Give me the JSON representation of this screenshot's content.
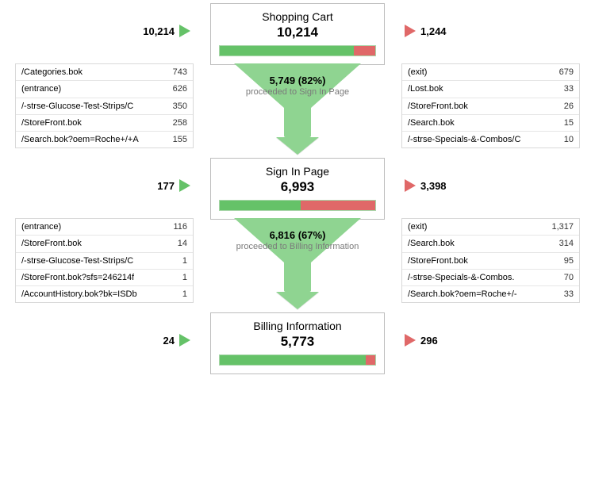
{
  "chart_data": {
    "type": "funnel",
    "stages": [
      {
        "label": "Shopping Cart",
        "count": 10214,
        "inflow": 10214,
        "outflow": 1244,
        "proceeded_count": 5749,
        "proceeded_rate": "82%",
        "proceeded_to": "Sign In Page"
      },
      {
        "label": "Sign In Page",
        "count": 6993,
        "inflow": 177,
        "outflow": 3398,
        "proceeded_count": 6816,
        "proceeded_rate": "67%",
        "proceeded_to": "Billing Information"
      },
      {
        "label": "Billing Information",
        "count": 5773,
        "inflow": 24,
        "outflow": 296
      }
    ]
  },
  "stages": [
    {
      "title": "Shopping Cart",
      "count": "10,214",
      "inflow": "10,214",
      "outflow": "1,244",
      "bar_red_style": "width:14%",
      "proceeded_num": "5,749 (82%)",
      "proceeded_txt": "proceeded to Sign In Page",
      "in_rows": [
        {
          "path": "/Categories.bok",
          "val": "743"
        },
        {
          "path": "(entrance)",
          "val": "626"
        },
        {
          "path": "/-strse-Glucose-Test-Strips/C",
          "val": "350"
        },
        {
          "path": "/StoreFront.bok",
          "val": "258"
        },
        {
          "path": "/Search.bok?oem=Roche+/+A",
          "val": "155"
        }
      ],
      "out_rows": [
        {
          "path": "(exit)",
          "val": "679"
        },
        {
          "path": "/Lost.bok",
          "val": "33"
        },
        {
          "path": "/StoreFront.bok",
          "val": "26"
        },
        {
          "path": "/Search.bok",
          "val": "15"
        },
        {
          "path": "/-strse-Specials-&-Combos/C",
          "val": "10"
        }
      ]
    },
    {
      "title": "Sign In Page",
      "count": "6,993",
      "inflow": "177",
      "outflow": "3,398",
      "bar_red_style": "width:48%",
      "proceeded_num": "6,816 (67%)",
      "proceeded_txt": "proceeded to Billing Information",
      "in_rows": [
        {
          "path": "(entrance)",
          "val": "116"
        },
        {
          "path": "/StoreFront.bok",
          "val": "14"
        },
        {
          "path": "/-strse-Glucose-Test-Strips/C",
          "val": "1"
        },
        {
          "path": "/StoreFront.bok?sfs=246214f",
          "val": "1"
        },
        {
          "path": "/AccountHistory.bok?bk=ISDb",
          "val": "1"
        }
      ],
      "out_rows": [
        {
          "path": "(exit)",
          "val": "1,317"
        },
        {
          "path": "/Search.bok",
          "val": "314"
        },
        {
          "path": "/StoreFront.bok",
          "val": "95"
        },
        {
          "path": "/-strse-Specials-&-Combos.",
          "val": "70"
        },
        {
          "path": "/Search.bok?oem=Roche+/-",
          "val": "33"
        }
      ]
    },
    {
      "title": "Billing Information",
      "count": "5,773",
      "inflow": "24",
      "outflow": "296",
      "bar_red_style": "width:6%"
    }
  ]
}
